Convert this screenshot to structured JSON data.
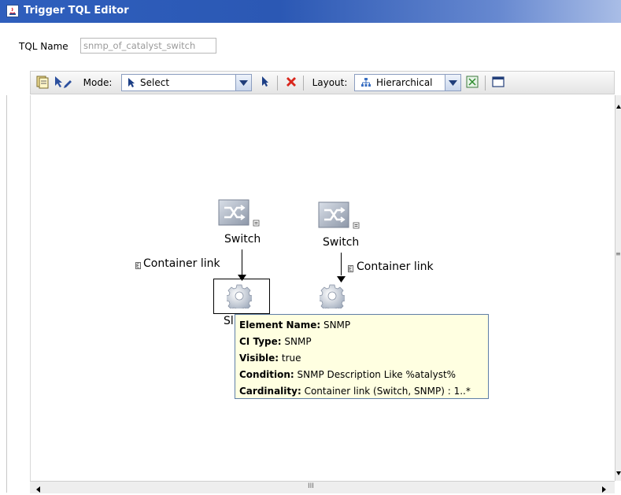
{
  "window": {
    "title": "Trigger TQL Editor"
  },
  "tql_name": {
    "label": "TQL Name",
    "value": "snmp_of_catalyst_switch"
  },
  "toolbar": {
    "mode_label": "Mode:",
    "mode_value": "Select",
    "layout_label": "Layout:",
    "layout_value": "Hierarchical"
  },
  "nodes": {
    "switch1_label": "Switch",
    "switch2_label": "Switch",
    "snmp1_label_partial": "Sl",
    "link1_label": "Container link",
    "link2_label": "Container link",
    "link_badge": "E"
  },
  "tooltip": {
    "element_name_key": "Element Name:",
    "element_name_val": " SNMP",
    "ci_type_key": "CI Type:",
    "ci_type_val": " SNMP",
    "visible_key": "Visible:",
    "visible_val": " true",
    "condition_key": "Condition:",
    "condition_val": " SNMP Description Like %atalyst%",
    "cardinality_key": "Cardinality:",
    "cardinality_val": " Container link (Switch, SNMP) : 1..*"
  },
  "scrollbars": {
    "grip_symbol": "III",
    "vgrip_symbol": "≡"
  },
  "icons": {
    "title": "java-app-icon",
    "tb_properties": "properties-icon",
    "tb_draw": "draw-link-icon",
    "mode_arrow": "cursor-icon",
    "select_cursor": "cursor-icon",
    "delete": "delete-x-icon",
    "layout_tree": "hierarchy-icon",
    "fit": "fit-to-window-icon",
    "maximize": "maximize-icon",
    "switch": "switch-icon",
    "snmp": "gear-icon"
  },
  "colors": {
    "titlebar": "#2f5fbd",
    "tooltip_bg": "#ffffe1",
    "delete": "#d9261c"
  }
}
